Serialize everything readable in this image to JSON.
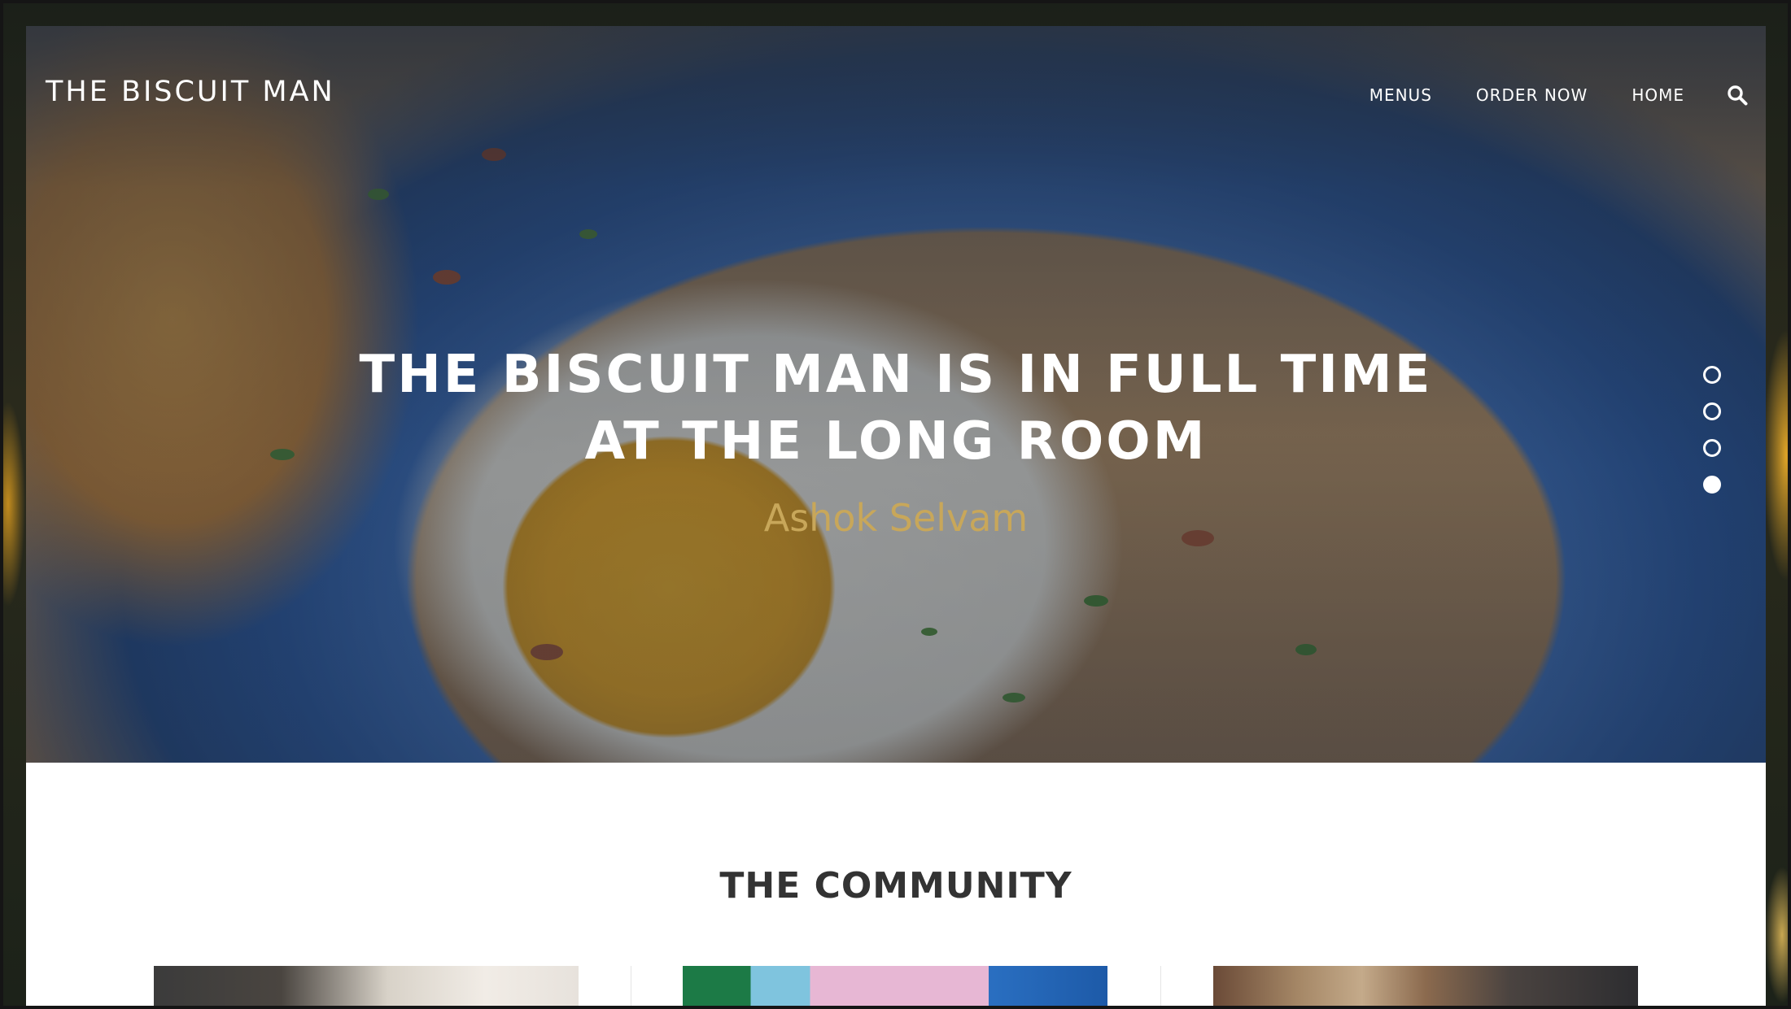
{
  "brand": {
    "name": "THE BISCUIT MAN"
  },
  "nav": {
    "items": [
      {
        "label": "MENUS"
      },
      {
        "label": "ORDER NOW"
      },
      {
        "label": "HOME"
      }
    ],
    "search_icon": "search-icon"
  },
  "hero": {
    "title_line1": "THE BISCUIT MAN IS IN FULL TIME",
    "title_line2": "AT THE LONG ROOM",
    "author": "Ashok Selvam",
    "author_color": "#c8a75a",
    "slides": 4,
    "active_slide": 4
  },
  "community": {
    "title": "THE COMMUNITY"
  }
}
